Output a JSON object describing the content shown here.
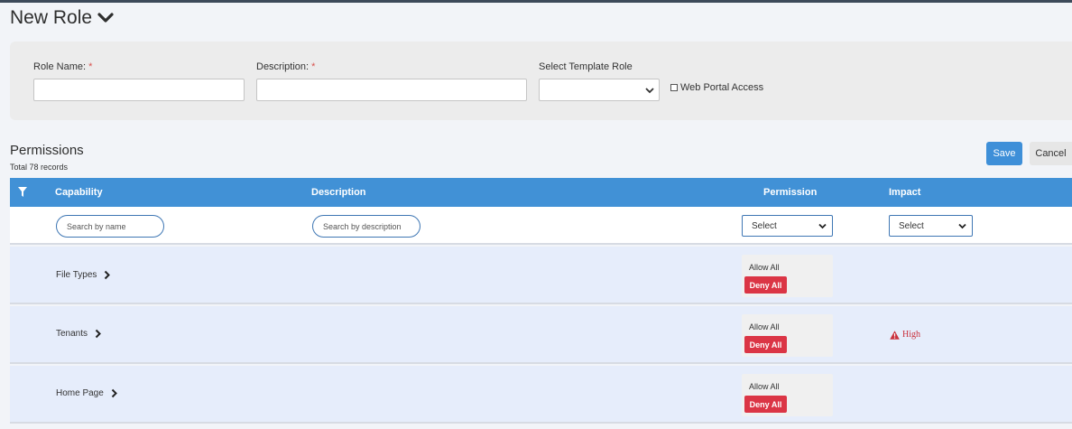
{
  "header": {
    "title": "New Role"
  },
  "form": {
    "role_name_label": "Role Name:",
    "description_label": "Description:",
    "required_mark": "*",
    "template_label": "Select Template Role",
    "template_value": "",
    "web_portal_label": "Web Portal Access",
    "role_name_value": "",
    "description_value": ""
  },
  "permissions": {
    "title": "Permissions",
    "count": "Total 78 records",
    "save_label": "Save",
    "cancel_label": "Cancel"
  },
  "grid": {
    "columns": [
      "Capability",
      "Description",
      "Permission",
      "Impact"
    ],
    "filters": {
      "name_placeholder": "Search by name",
      "description_placeholder": "Search by description",
      "permission_select": "Select",
      "impact_select": "Select"
    },
    "rows": [
      {
        "name": "File Types",
        "allow_label": "Allow All",
        "deny_label": "Deny All",
        "impact": ""
      },
      {
        "name": "Tenants",
        "allow_label": "Allow All",
        "deny_label": "Deny All",
        "impact": "High"
      },
      {
        "name": "Home Page",
        "allow_label": "Allow All",
        "deny_label": "Deny All",
        "impact": ""
      }
    ]
  },
  "colors": {
    "header_blue": "#4191d6",
    "row_bg": "#e6edfb",
    "deny_red": "#db3545",
    "save_blue": "#3e8fd8",
    "impact_red": "#c9303c"
  }
}
